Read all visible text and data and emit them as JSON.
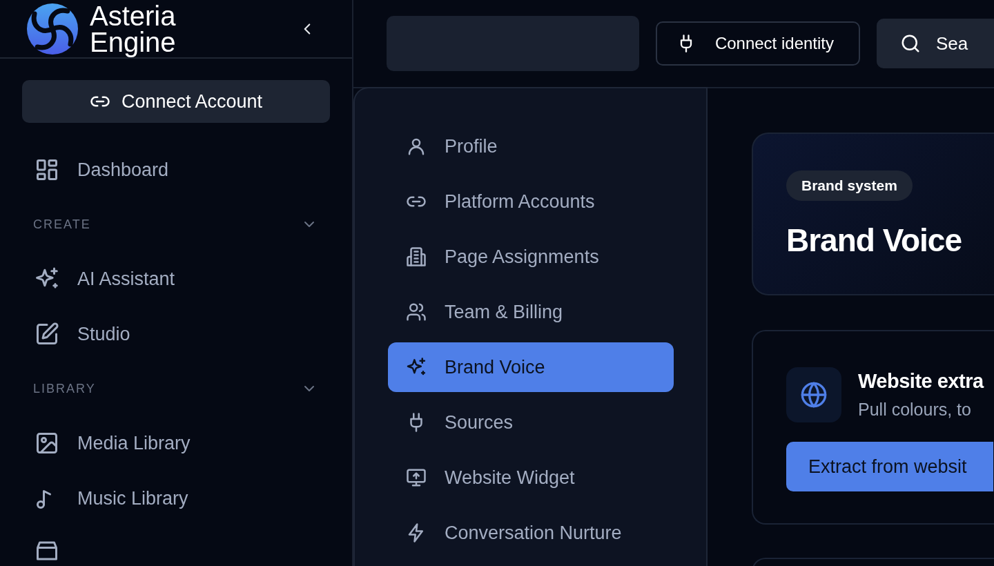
{
  "app": {
    "name_line1": "Asteria",
    "name_line2": "Engine"
  },
  "sidebar": {
    "connect_button": "Connect Account",
    "top_items": [
      {
        "label": "Dashboard"
      }
    ],
    "sections": [
      {
        "title": "CREATE",
        "expanded": true,
        "items": [
          {
            "label": "AI Assistant"
          },
          {
            "label": "Studio"
          }
        ]
      },
      {
        "title": "LIBRARY",
        "expanded": true,
        "items": [
          {
            "label": "Media Library"
          },
          {
            "label": "Music Library"
          }
        ]
      }
    ]
  },
  "topbar": {
    "connect_button": "Connect identity",
    "search_button": "Sea"
  },
  "settings_nav": [
    {
      "label": "Profile",
      "selected": false
    },
    {
      "label": "Platform Accounts",
      "selected": false
    },
    {
      "label": "Page Assignments",
      "selected": false
    },
    {
      "label": "Team & Billing",
      "selected": false
    },
    {
      "label": "Brand Voice",
      "selected": true
    },
    {
      "label": "Sources",
      "selected": false
    },
    {
      "label": "Website Widget",
      "selected": false
    },
    {
      "label": "Conversation Nurture",
      "selected": false
    }
  ],
  "hero": {
    "badge": "Brand system",
    "title": "Brand Voice"
  },
  "extract_card": {
    "title": "Website extra",
    "subtitle": "Pull colours, to",
    "button": "Extract from websit"
  }
}
